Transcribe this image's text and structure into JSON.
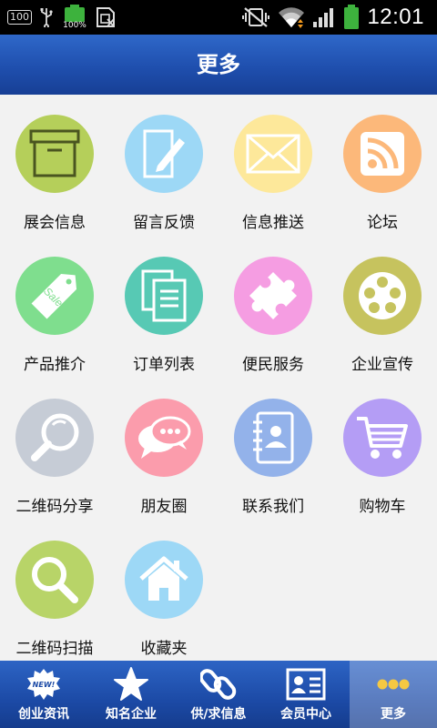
{
  "status_bar": {
    "battery_small": "100",
    "battery_percent": "100%",
    "time": "12:01"
  },
  "header": {
    "title": "更多"
  },
  "grid": {
    "items": [
      {
        "label": "展会信息",
        "icon": "box-icon",
        "color": "#b5cf5a"
      },
      {
        "label": "留言反馈",
        "icon": "edit-note-icon",
        "color": "#9dd8f6"
      },
      {
        "label": "信息推送",
        "icon": "envelope-icon",
        "color": "#fde89a"
      },
      {
        "label": "论坛",
        "icon": "rss-icon",
        "color": "#fcb87a"
      },
      {
        "label": "产品推介",
        "icon": "sale-tag-icon",
        "color": "#7fde8e"
      },
      {
        "label": "订单列表",
        "icon": "document-list-icon",
        "color": "#57c9b4"
      },
      {
        "label": "便民服务",
        "icon": "puzzle-icon",
        "color": "#f59de2"
      },
      {
        "label": "企业宣传",
        "icon": "film-reel-icon",
        "color": "#c6c35e"
      },
      {
        "label": "二维码分享",
        "icon": "magnifier-icon",
        "color": "#c6ccd6"
      },
      {
        "label": "朋友圈",
        "icon": "chat-bubbles-icon",
        "color": "#fb9cac"
      },
      {
        "label": "联系我们",
        "icon": "contact-book-icon",
        "color": "#93b2ea"
      },
      {
        "label": "购物车",
        "icon": "shopping-cart-icon",
        "color": "#b49df5"
      },
      {
        "label": "二维码扫描",
        "icon": "search-icon",
        "color": "#b8d468"
      },
      {
        "label": "收藏夹",
        "icon": "home-icon",
        "color": "#9dd8f6"
      }
    ]
  },
  "tabbar": {
    "tabs": [
      {
        "label": "创业资讯",
        "icon": "new-badge-icon",
        "badge_text": "NEW!"
      },
      {
        "label": "知名企业",
        "icon": "star-icon"
      },
      {
        "label": "供/求信息",
        "icon": "chain-link-icon"
      },
      {
        "label": "会员中心",
        "icon": "member-card-icon"
      },
      {
        "label": "更多",
        "icon": "more-dots-icon"
      }
    ],
    "active_tab": "更多"
  }
}
